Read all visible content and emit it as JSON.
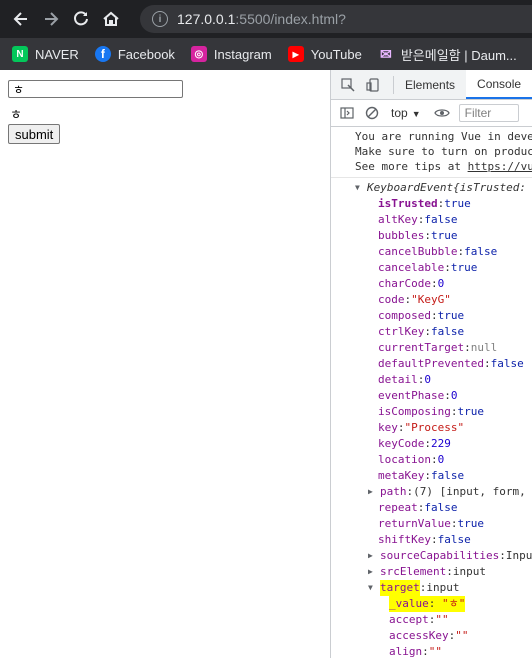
{
  "browser": {
    "url_host": "127.0.0.1",
    "url_path": ":5500/index.html?",
    "nav": {
      "back_icon": "arrow-left",
      "forward_icon": "arrow-right",
      "reload_icon": "reload",
      "home_icon": "home"
    },
    "bookmarks": [
      {
        "label": "NAVER",
        "icon": "N",
        "color": "#03c75a"
      },
      {
        "label": "Facebook",
        "icon": "f",
        "color": "#1877f2"
      },
      {
        "label": "Instagram",
        "icon": "◎",
        "color": "#d6249f"
      },
      {
        "label": "YouTube",
        "icon": "▶",
        "color": "#ff0000"
      },
      {
        "label": "받은메일함 | Daum...",
        "icon": "✉",
        "color": "#6d6d6d"
      }
    ]
  },
  "page": {
    "input_value": "ㅎ",
    "echo_text": "ㅎ",
    "submit_label": "submit"
  },
  "devtools": {
    "tabs": [
      "Elements",
      "Console"
    ],
    "active_tab": "Console",
    "context": "top",
    "filter_placeholder": "Filter",
    "vue_message": {
      "line1": "You are running Vue in deve",
      "line2": "Make sure to turn on produc",
      "line3_prefix": "See more tips at ",
      "line3_link": "https://vu"
    },
    "event_header": {
      "type": "KeyboardEvent",
      "rest": " {isTrusted:"
    },
    "props": [
      {
        "key": "isTrusted",
        "value": "true",
        "kind": "bool",
        "bold": true
      },
      {
        "key": "altKey",
        "value": "false",
        "kind": "bool"
      },
      {
        "key": "bubbles",
        "value": "true",
        "kind": "bool"
      },
      {
        "key": "cancelBubble",
        "value": "false",
        "kind": "bool"
      },
      {
        "key": "cancelable",
        "value": "true",
        "kind": "bool"
      },
      {
        "key": "charCode",
        "value": "0",
        "kind": "num"
      },
      {
        "key": "code",
        "value": "\"KeyG\"",
        "kind": "str"
      },
      {
        "key": "composed",
        "value": "true",
        "kind": "bool"
      },
      {
        "key": "ctrlKey",
        "value": "false",
        "kind": "bool"
      },
      {
        "key": "currentTarget",
        "value": "null",
        "kind": "null"
      },
      {
        "key": "defaultPrevented",
        "value": "false",
        "kind": "bool"
      },
      {
        "key": "detail",
        "value": "0",
        "kind": "num"
      },
      {
        "key": "eventPhase",
        "value": "0",
        "kind": "num"
      },
      {
        "key": "isComposing",
        "value": "true",
        "kind": "bool"
      },
      {
        "key": "key",
        "value": "\"Process\"",
        "kind": "str"
      },
      {
        "key": "keyCode",
        "value": "229",
        "kind": "num"
      },
      {
        "key": "location",
        "value": "0",
        "kind": "num"
      },
      {
        "key": "metaKey",
        "value": "false",
        "kind": "bool"
      }
    ],
    "path_row": {
      "key": "path",
      "value": "(7) [input, form,"
    },
    "props2": [
      {
        "key": "repeat",
        "value": "false",
        "kind": "bool"
      },
      {
        "key": "returnValue",
        "value": "true",
        "kind": "bool"
      },
      {
        "key": "shiftKey",
        "value": "false",
        "kind": "bool"
      }
    ],
    "source_caps_row": {
      "key": "sourceCapabilities",
      "value": "Inpu"
    },
    "src_element_row": {
      "key": "srcElement",
      "value": "input"
    },
    "target_row": {
      "key": "target",
      "value": "input"
    },
    "target_children": [
      {
        "key": "_value",
        "value": "\"ㅎ\"",
        "highlight": true
      },
      {
        "key": "accept",
        "value": "\"\""
      },
      {
        "key": "accessKey",
        "value": "\"\""
      },
      {
        "key": "align",
        "value": "\"\""
      }
    ]
  }
}
